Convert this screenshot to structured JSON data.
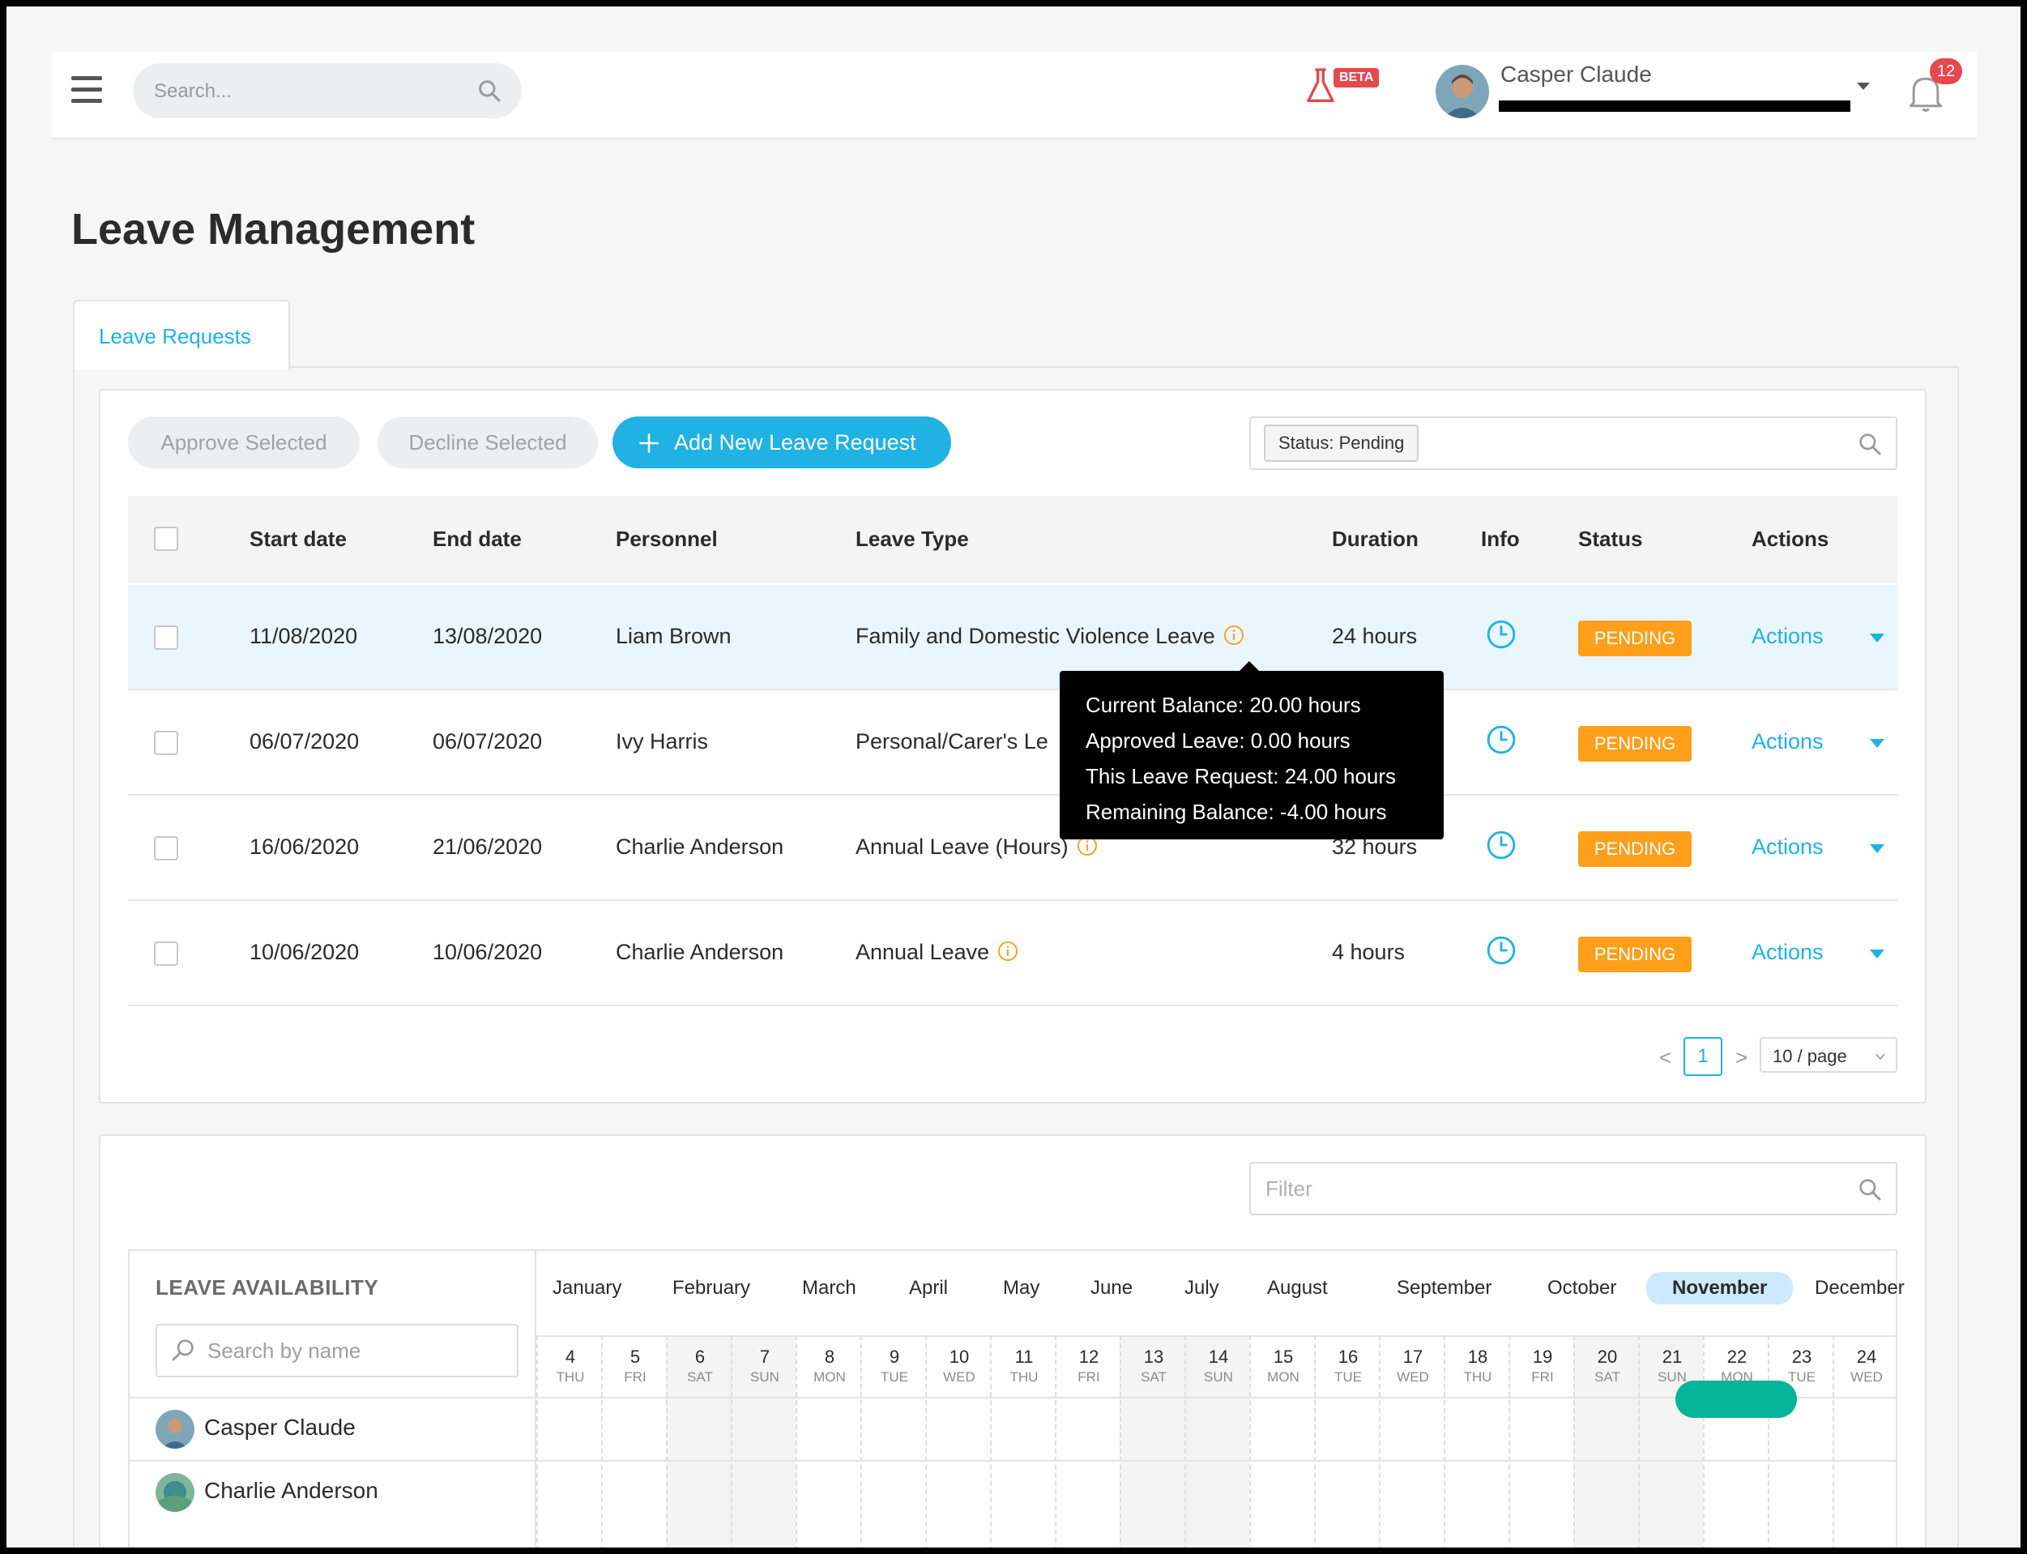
{
  "header": {
    "search_placeholder": "Search...",
    "beta_label": "BETA",
    "user_name": "Casper Claude",
    "notification_count": "12"
  },
  "page": {
    "title": "Leave Management"
  },
  "tabs": [
    {
      "label": "Leave Requests"
    }
  ],
  "toolbar": {
    "approve_label": "Approve Selected",
    "decline_label": "Decline Selected",
    "add_label": "Add New Leave Request",
    "filter_tag": "Status: Pending"
  },
  "table": {
    "columns": [
      "Start date",
      "End date",
      "Personnel",
      "Leave Type",
      "Duration",
      "Info",
      "Status",
      "Actions"
    ],
    "rows": [
      {
        "start": "11/08/2020",
        "end": "13/08/2020",
        "personnel": "Liam Brown",
        "leave_type": "Family and Domestic Violence Leave",
        "duration": "24 hours",
        "status": "PENDING",
        "action": "Actions"
      },
      {
        "start": "06/07/2020",
        "end": "06/07/2020",
        "personnel": "Ivy Harris",
        "leave_type": "Personal/Carer's Le",
        "duration": "",
        "status": "PENDING",
        "action": "Actions"
      },
      {
        "start": "16/06/2020",
        "end": "21/06/2020",
        "personnel": "Charlie Anderson",
        "leave_type": "Annual Leave (Hours)",
        "duration": "32 hours",
        "status": "PENDING",
        "action": "Actions"
      },
      {
        "start": "10/06/2020",
        "end": "10/06/2020",
        "personnel": "Charlie Anderson",
        "leave_type": "Annual Leave",
        "duration": "4 hours",
        "status": "PENDING",
        "action": "Actions"
      }
    ]
  },
  "tooltip": {
    "lines": [
      "Current Balance: 20.00 hours",
      "Approved Leave: 0.00 hours",
      "This Leave Request: 24.00 hours",
      "Remaining Balance: -4.00 hours"
    ]
  },
  "pagination": {
    "prev": "<",
    "current": "1",
    "next": ">",
    "page_size": "10 / page"
  },
  "availability": {
    "filter_placeholder": "Filter",
    "title": "LEAVE AVAILABILITY",
    "name_search_placeholder": "Search by name",
    "months": [
      "January",
      "February",
      "March",
      "April",
      "May",
      "June",
      "July",
      "August",
      "September",
      "October",
      "November",
      "December"
    ],
    "active_month": "November",
    "days": [
      {
        "num": "4",
        "dow": "THU",
        "weekend": false
      },
      {
        "num": "5",
        "dow": "FRI",
        "weekend": false
      },
      {
        "num": "6",
        "dow": "SAT",
        "weekend": true
      },
      {
        "num": "7",
        "dow": "SUN",
        "weekend": true
      },
      {
        "num": "8",
        "dow": "MON",
        "weekend": false
      },
      {
        "num": "9",
        "dow": "TUE",
        "weekend": false
      },
      {
        "num": "10",
        "dow": "WED",
        "weekend": false
      },
      {
        "num": "11",
        "dow": "THU",
        "weekend": false
      },
      {
        "num": "12",
        "dow": "FRI",
        "weekend": false
      },
      {
        "num": "13",
        "dow": "SAT",
        "weekend": true
      },
      {
        "num": "14",
        "dow": "SUN",
        "weekend": true
      },
      {
        "num": "15",
        "dow": "MON",
        "weekend": false
      },
      {
        "num": "16",
        "dow": "TUE",
        "weekend": false
      },
      {
        "num": "17",
        "dow": "WED",
        "weekend": false
      },
      {
        "num": "18",
        "dow": "THU",
        "weekend": false
      },
      {
        "num": "19",
        "dow": "FRI",
        "weekend": false
      },
      {
        "num": "20",
        "dow": "SAT",
        "weekend": true
      },
      {
        "num": "21",
        "dow": "SUN",
        "weekend": true
      },
      {
        "num": "22",
        "dow": "MON",
        "weekend": false
      },
      {
        "num": "23",
        "dow": "TUE",
        "weekend": false
      },
      {
        "num": "24",
        "dow": "WED",
        "weekend": false
      }
    ],
    "people": [
      {
        "name": "Casper Claude",
        "leave_days": [
          "23",
          "24"
        ]
      },
      {
        "name": "Charlie Anderson",
        "leave_days": []
      }
    ]
  },
  "colors": {
    "accent": "#1fb2e3",
    "pending": "#ff9f1c",
    "leave_bar": "#06b49a",
    "badge_red": "#e5484d",
    "highlight_row": "#e9f6fd",
    "active_month_bg": "#cde9fb"
  },
  "icons": {
    "menu": "hamburger-icon",
    "search": "search-icon",
    "beta": "flask-icon",
    "notifications": "bell-icon",
    "info": "info-icon",
    "clock": "clock-icon",
    "add": "plus-icon",
    "dropdown": "caret-down-icon"
  }
}
